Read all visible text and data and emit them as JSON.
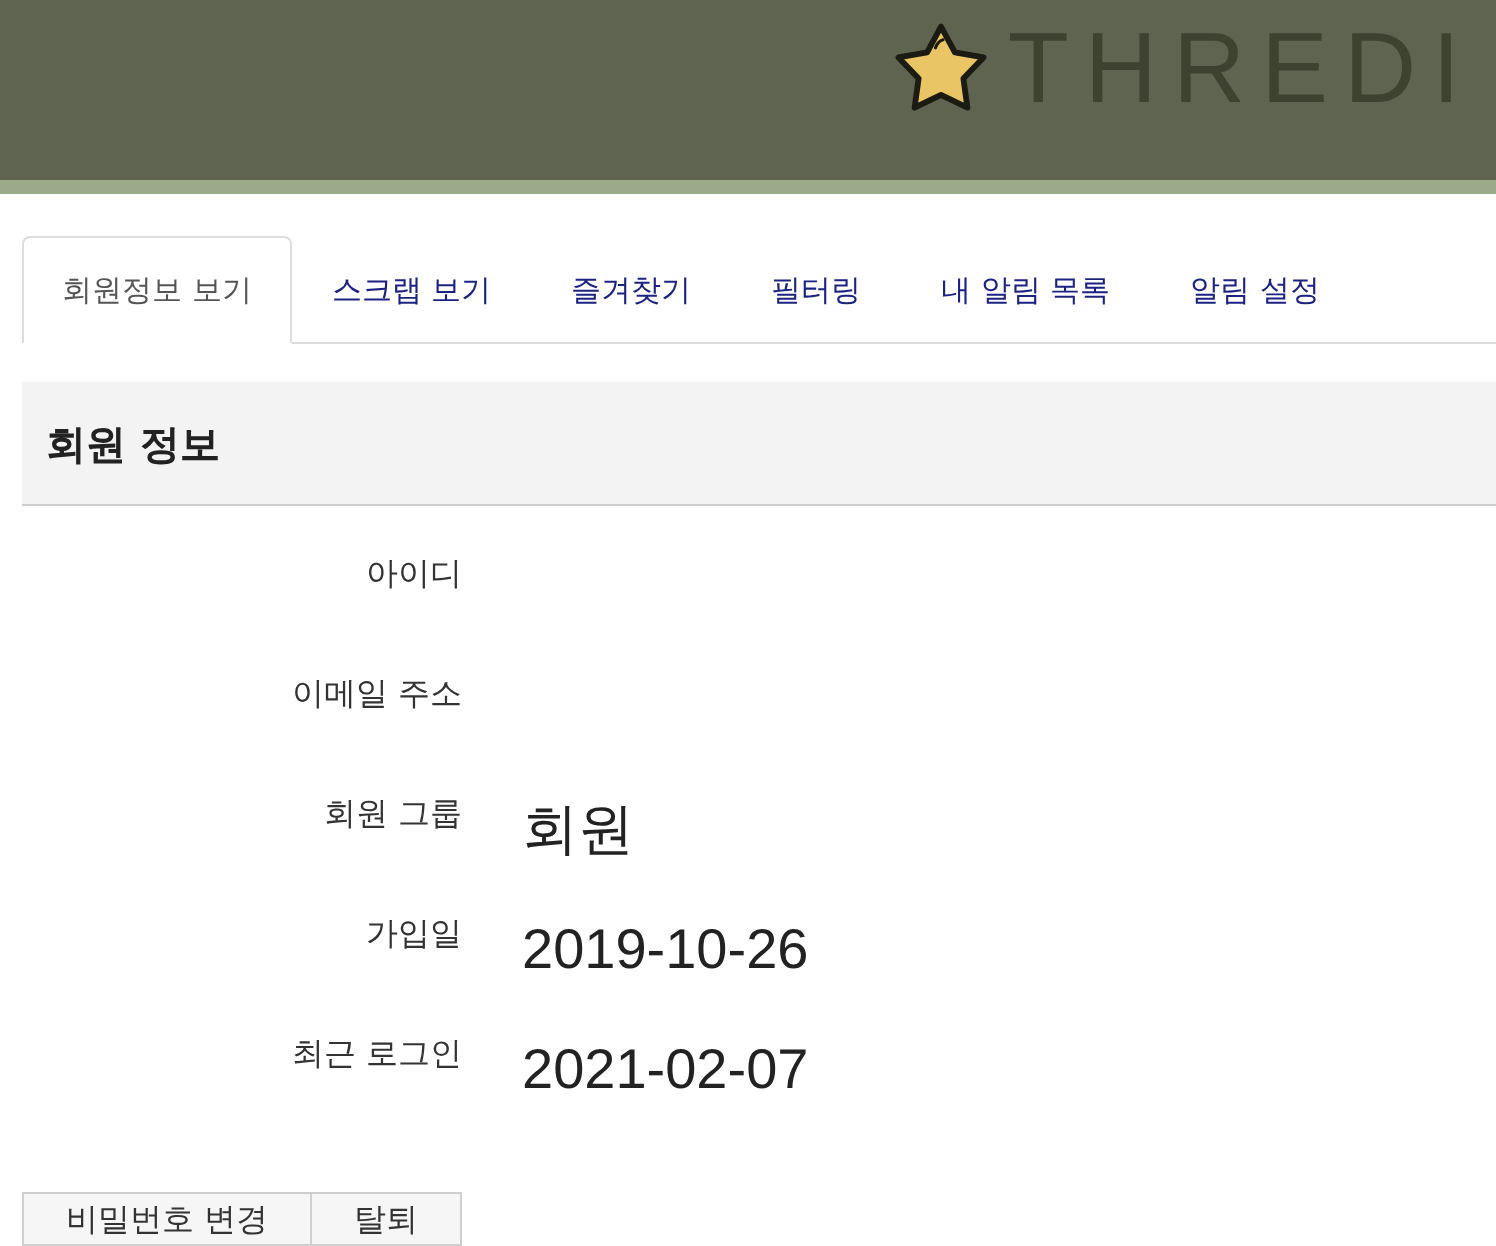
{
  "header": {
    "logo_text": "THREDI"
  },
  "tabs": [
    {
      "label": "회원정보 보기",
      "selected": true
    },
    {
      "label": "스크랩 보기",
      "selected": false
    },
    {
      "label": "즐겨찾기",
      "selected": false
    },
    {
      "label": "필터링",
      "selected": false
    },
    {
      "label": "내 알림 목록",
      "selected": false
    },
    {
      "label": "알림 설정",
      "selected": false
    }
  ],
  "section": {
    "title": "회원 정보",
    "fields": [
      {
        "label": "아이디"
      },
      {
        "label": "이메일 주소"
      },
      {
        "label": "회원 그룹",
        "value": "회원"
      },
      {
        "label": "가입일",
        "value": "2019-10-26"
      },
      {
        "label": "최근 로그인",
        "value": "2021-02-07"
      }
    ]
  },
  "buttons": [
    "비밀번호 변경",
    "탈퇴"
  ]
}
